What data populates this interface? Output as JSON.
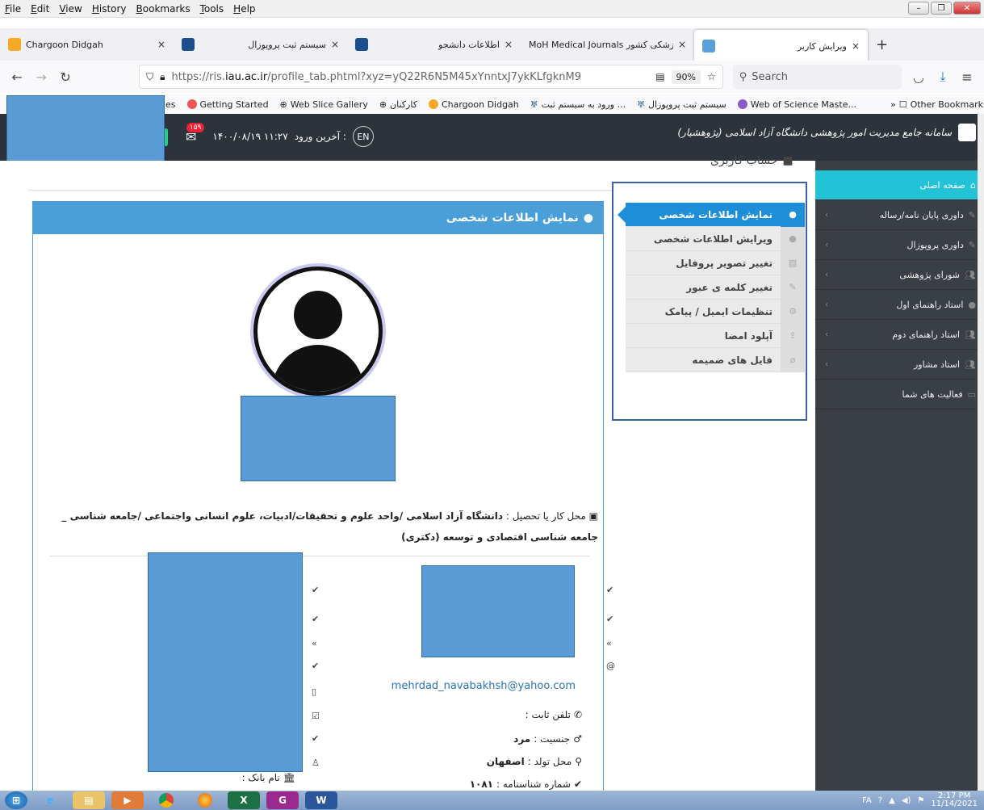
{
  "menubar": {
    "items": [
      "File",
      "Edit",
      "View",
      "History",
      "Bookmarks",
      "Tools",
      "Help"
    ]
  },
  "tabs": [
    {
      "title": "Chargoon Didgah",
      "close": "×"
    },
    {
      "title": "سیستم ثبت پروپوزال",
      "close": "×"
    },
    {
      "title": "اطلاعات دانشجو",
      "close": "×"
    },
    {
      "title": "MoH Medical Journals پزشکی کشور",
      "close": "×"
    },
    {
      "title": "ویرایش کاربر",
      "close": "×"
    }
  ],
  "new_tab": "+",
  "nav": {
    "url_host": "https://ris.",
    "url_domain": "iau.ac.ir",
    "url_path": "/profile_tab.phtml?xyz=yQ22R6N5M45xYnntxJ7ykKLfgknM9",
    "zoom": "90%",
    "search_placeholder": "Search"
  },
  "bookmarks": [
    {
      "label": "es",
      "color": "#fff"
    },
    {
      "label": "Getting Started",
      "color": "#e55"
    },
    {
      "label": "Web Slice Gallery",
      "color": "#888"
    },
    {
      "label": "کارکنان",
      "color": "#888"
    },
    {
      "label": "Chargoon Didgah",
      "color": "#f9a825"
    },
    {
      "label": "ورود به سیستم ثبت ...",
      "color": "#1a4e8c"
    },
    {
      "label": "سیستم ثبت پروپوزال",
      "color": "#1a4e8c"
    },
    {
      "label": "Web of Science Maste...",
      "color": "#8a5cc7"
    },
    {
      "label": "Other Bookmarks",
      "color": "#888"
    }
  ],
  "header": {
    "site_title": "سامانه جامع مدیریت امور پژوهشی دانشگاه آزاد اسلامی (پژوهشیار)",
    "last_login_label": "آخرین ورود :",
    "last_login_value": "۱۴۰۰/۰۸/۱۹ ۱۱:۲۷",
    "lang": "EN",
    "mail_count": "۱۵۹"
  },
  "breadcrumb": "حساب کاربری",
  "sidebar": {
    "items": [
      {
        "label": "صفحه اصلی",
        "icon": "home-icon",
        "active": true
      },
      {
        "label": "داوری پایان نامه/رساله",
        "icon": "pen-icon"
      },
      {
        "label": "داوری پروپوزال",
        "icon": "pen-icon"
      },
      {
        "label": "شورای پژوهشی",
        "icon": "group-icon"
      },
      {
        "label": "استاد راهنمای اول",
        "icon": "user-icon"
      },
      {
        "label": "استاد راهنمای دوم",
        "icon": "group-icon"
      },
      {
        "label": "استاد مشاور",
        "icon": "group-icon"
      },
      {
        "label": "فعالیت های شما",
        "icon": "laptop-icon"
      }
    ]
  },
  "submenu": {
    "items": [
      {
        "label": "نمایش اطلاعات شخصی",
        "active": true
      },
      {
        "label": "ویرایش اطلاعات شخصی"
      },
      {
        "label": "تغییر تصویر پروفایل"
      },
      {
        "label": "تغییر کلمه ی عبور"
      },
      {
        "label": "تنظیمات ایمیل / پیامک"
      },
      {
        "label": "آپلود امضا"
      },
      {
        "label": "فایل های ضمیمه"
      }
    ]
  },
  "card": {
    "title": "نمایش اطلاعات شخصی",
    "workplace_label": "محل کار یا تحصیل :",
    "workplace_value": "دانشگاه آزاد اسلامی /واحد علوم و تحقیقات/ادبیات، علوم انسانی واجتماعی /جامعه شناسی _ جامعه شناسی اقتصادی و توسعه (دکتری)",
    "email": "mehrdad_navabakhsh@yahoo.com",
    "phone_label": "تلفن ثابت :",
    "gender_label": "جنسیت :",
    "gender_value": "مرد",
    "birthplace_label": "محل تولد :",
    "birthplace_value": "اصفهان",
    "id_label": "شماره شناسنامه :",
    "id_value": "۱۰۸۱",
    "bank_label": "نام بانک :"
  },
  "tray": {
    "lang": "FA",
    "time": "2:17 PM",
    "date": "11/14/2021"
  }
}
